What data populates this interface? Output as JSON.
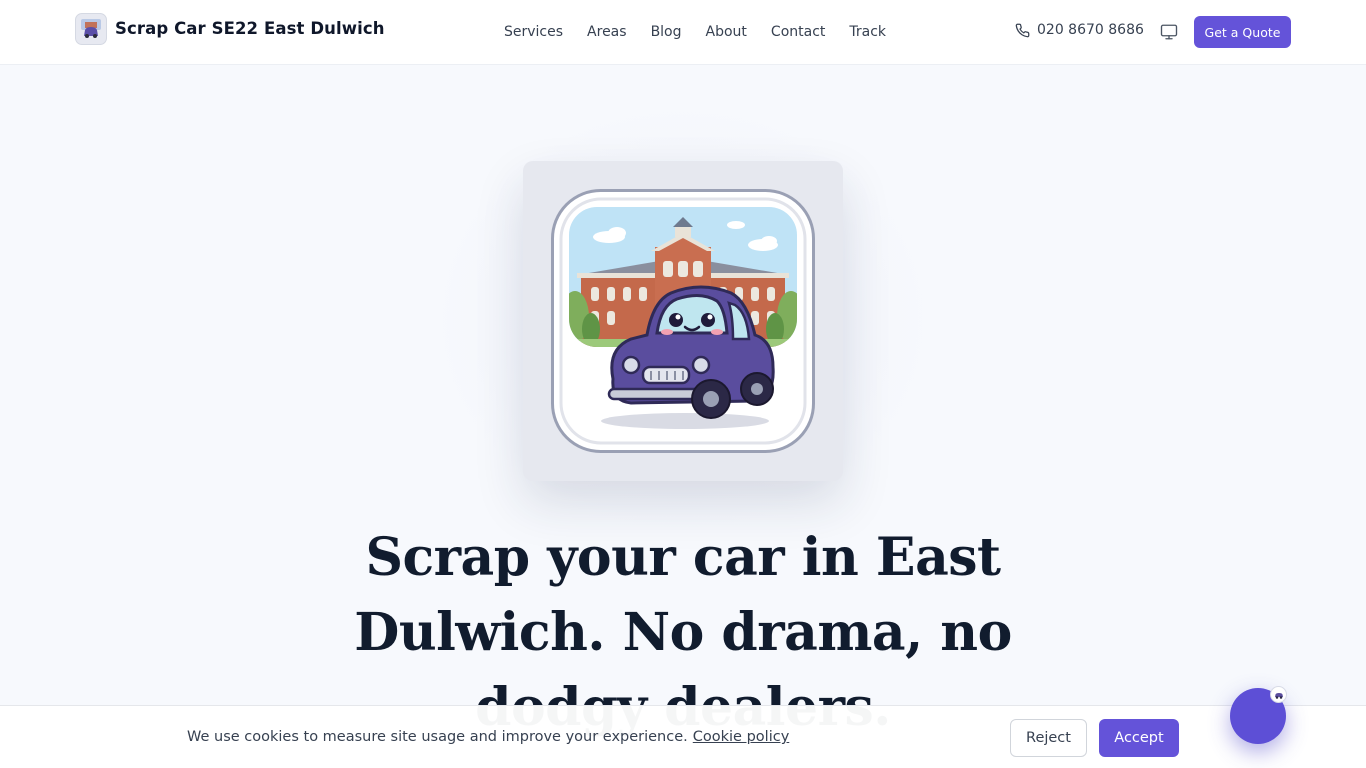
{
  "header": {
    "brand_name": "Scrap Car SE22 East Dulwich",
    "logo_icon": "car-mascot-icon",
    "nav": [
      {
        "label": "Services"
      },
      {
        "label": "Areas"
      },
      {
        "label": "Blog"
      },
      {
        "label": "About"
      },
      {
        "label": "Contact"
      },
      {
        "label": "Track"
      }
    ],
    "phone_icon": "phone-icon",
    "phone": "020 8670 8686",
    "theme_icon": "monitor-icon",
    "cta_label": "Get a Quote"
  },
  "hero": {
    "image_icon": "car-mascot-illustration",
    "title": "Scrap your car in East Dulwich. No drama, no dodgy dealers."
  },
  "cookie_banner": {
    "message": "We use cookies to measure site usage and improve your experience.",
    "policy_link": "Cookie policy",
    "reject_label": "Reject",
    "accept_label": "Accept"
  },
  "chat": {
    "icon": "chat-icon"
  },
  "colors": {
    "accent": "#6453d9",
    "page_background": "#f7f9fd",
    "heading": "#111c2e",
    "text": "#374151"
  }
}
